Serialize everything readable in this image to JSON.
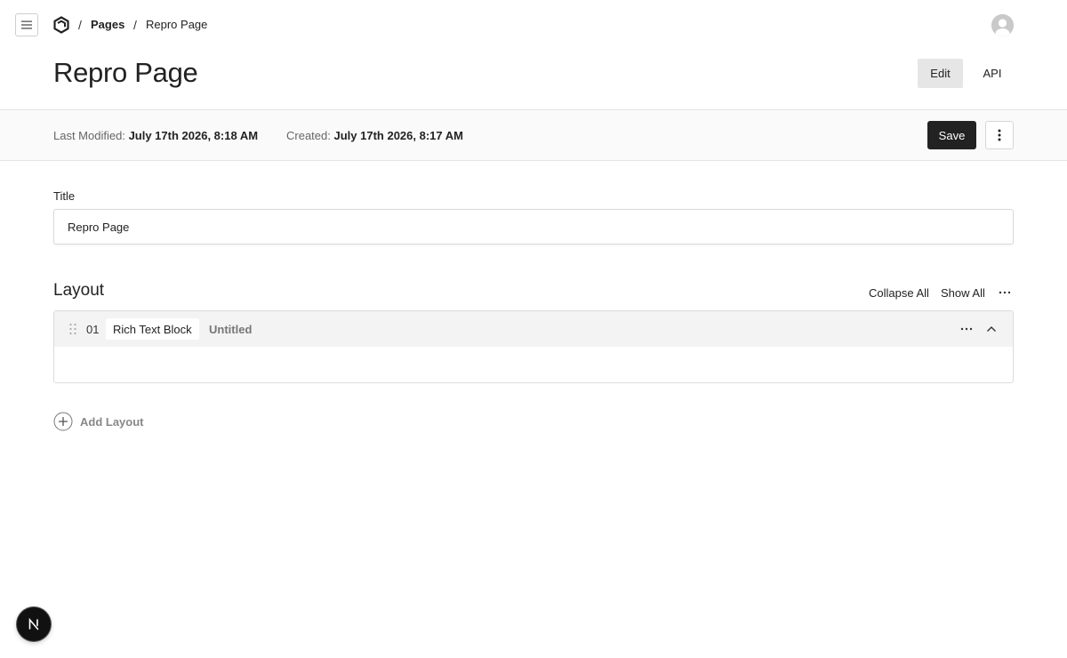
{
  "breadcrumb": {
    "sep": "/",
    "items": [
      {
        "label": "Pages"
      },
      {
        "label": "Repro Page"
      }
    ]
  },
  "header": {
    "title": "Repro Page",
    "tabs": [
      {
        "label": "Edit",
        "active": true
      },
      {
        "label": "API",
        "active": false
      }
    ]
  },
  "meta": {
    "last_modified_label": "Last Modified:",
    "last_modified_value": "July 17th 2026, 8:18 AM",
    "created_label": "Created:",
    "created_value": "July 17th 2026, 8:17 AM"
  },
  "actions": {
    "save_label": "Save"
  },
  "form": {
    "title_label": "Title",
    "title_value": "Repro Page"
  },
  "layout": {
    "heading": "Layout",
    "collapse_all": "Collapse All",
    "show_all": "Show All",
    "blocks": [
      {
        "number": "01",
        "type": "Rich Text Block",
        "label": "Untitled"
      }
    ],
    "add_label": "Add Layout"
  },
  "colors": {
    "primary_button": "#222222",
    "active_tab": "#e6e6e6",
    "block_header": "#f3f3f3"
  },
  "icons": {
    "menu": "hamburger-icon",
    "logo": "payload-logo-icon",
    "avatar": "user-avatar-icon",
    "more": "more-horizontal-icon",
    "kebab": "more-vertical-icon",
    "drag": "drag-handle-icon",
    "collapse": "chevron-up-icon",
    "add": "plus-circle-icon",
    "dev": "nextjs-n-icon"
  }
}
